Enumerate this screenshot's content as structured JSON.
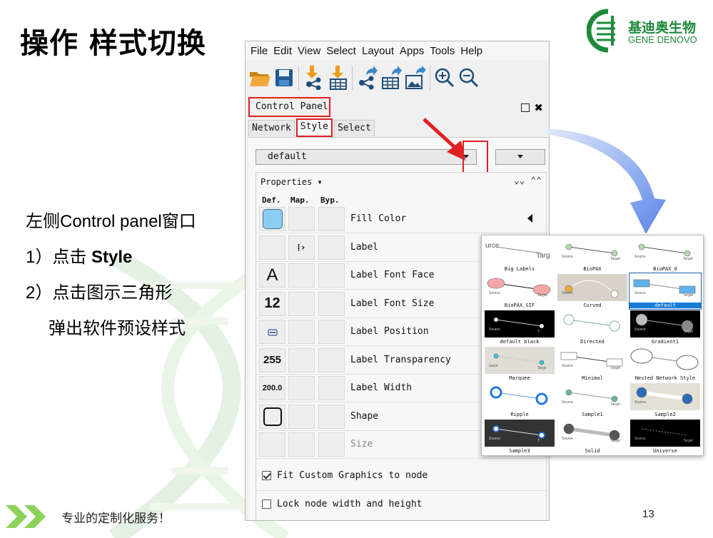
{
  "slide": {
    "title": "操作 样式切换",
    "logo_cn": "基迪奥生物",
    "logo_en": "GENE DENOVO",
    "instructions": {
      "line1": "左侧Control panel窗口",
      "line2_prefix": "1）点击 ",
      "line2_bold": "Style",
      "line3": "2）点击图示三角形",
      "line4": "弹出软件预设样式"
    },
    "footer": "专业的定制化服务！",
    "page_number": "13"
  },
  "app": {
    "menu": [
      "File",
      "Edit",
      "View",
      "Select",
      "Layout",
      "Apps",
      "Tools",
      "Help"
    ],
    "toolbar_icons": [
      "open-folder-icon",
      "save-icon",
      "import-network-icon",
      "import-table-icon",
      "export-network-icon",
      "export-table-icon",
      "export-image-icon",
      "zoom-in-icon",
      "zoom-out-icon"
    ],
    "control_panel": {
      "title": "Control Panel",
      "tabs": [
        "Network",
        "Style",
        "Select"
      ],
      "active_tab": "Style",
      "style_value": "default",
      "properties_label": "Properties",
      "col_def": "Def.",
      "col_map": "Map.",
      "col_byp": "Byp.",
      "properties": [
        {
          "name": "Fill Color",
          "def": "",
          "def_kind": "color"
        },
        {
          "name": "Label",
          "def": "",
          "def_kind": "empty"
        },
        {
          "name": "Label Font Face",
          "def": "A",
          "def_kind": "text"
        },
        {
          "name": "Label Font Size",
          "def": "12",
          "def_kind": "text"
        },
        {
          "name": "Label Position",
          "def": "",
          "def_kind": "position"
        },
        {
          "name": "Label Transparency",
          "def": "255",
          "def_kind": "text"
        },
        {
          "name": "Label Width",
          "def": "200.0",
          "def_kind": "text"
        },
        {
          "name": "Shape",
          "def": "",
          "def_kind": "shape"
        },
        {
          "name": "Size",
          "def": "",
          "def_kind": "empty"
        }
      ],
      "fit_custom_graphics": "Fit Custom Graphics to node",
      "lock_node": "Lock node width and height"
    }
  },
  "presets": [
    {
      "label": "Big Labels",
      "src": "urce",
      "tgt": "Targ"
    },
    {
      "label": "BioPAX",
      "src": "Source",
      "tgt": "Target"
    },
    {
      "label": "BioPAX_0",
      "src": "Source",
      "tgt": "Target"
    },
    {
      "label": "BioPAX_SIF",
      "src": "Source",
      "tgt": "Target"
    },
    {
      "label": "Curved",
      "src": "Source",
      "tgt": ""
    },
    {
      "label": "default",
      "src": "Source",
      "tgt": "Target"
    },
    {
      "label": "default black",
      "src": "Source",
      "tgt": "T"
    },
    {
      "label": "Directed",
      "src": "",
      "tgt": ""
    },
    {
      "label": "Gradient1",
      "src": "Source",
      "tgt": "Target"
    },
    {
      "label": "Marquee",
      "src": "ource",
      "tgt": "Targe"
    },
    {
      "label": "Minimal",
      "src": "Source",
      "tgt": "Target"
    },
    {
      "label": "Nested Network Style",
      "src": "",
      "tgt": ""
    },
    {
      "label": "Ripple",
      "src": "",
      "tgt": ""
    },
    {
      "label": "Sample1",
      "src": "Source",
      "tgt": "Target"
    },
    {
      "label": "Sample2",
      "src": "Source",
      "tgt": ""
    },
    {
      "label": "Sample3",
      "src": "Source",
      "tgt": "T"
    },
    {
      "label": "Solid",
      "src": "Source",
      "tgt": "Target"
    },
    {
      "label": "Universe",
      "src": "Source",
      "tgt": "Target"
    }
  ],
  "colors": {
    "accent_red": "#e02020",
    "brand_green": "#1e8a3c",
    "fill_color_swatch": "#8ccdf2",
    "selection_blue": "#1a7ad8"
  }
}
